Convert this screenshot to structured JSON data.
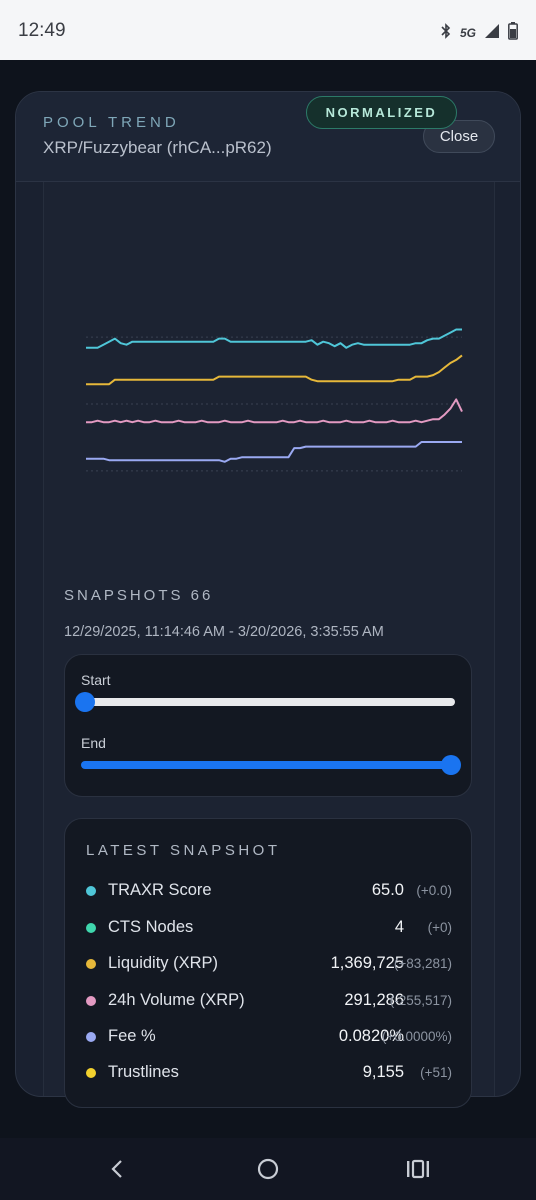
{
  "status_bar": {
    "time": "12:49",
    "network": "5G",
    "icons": [
      "bluetooth-icon",
      "signal-icon",
      "battery-icon"
    ]
  },
  "header": {
    "eyebrow": "POOL TREND",
    "pool_name": "XRP/Fuzzybear (rhCA...pR62)",
    "close_label": "Close"
  },
  "badge": "NORMALIZED",
  "chart_data": {
    "type": "line",
    "title": "",
    "normalized": true,
    "grid": true,
    "x_count": 66,
    "series": [
      {
        "color": "#4fc6d8",
        "values": [
          0.87,
          0.87,
          0.87,
          0.89,
          0.91,
          0.93,
          0.9,
          0.89,
          0.91,
          0.91,
          0.91,
          0.91,
          0.91,
          0.91,
          0.91,
          0.91,
          0.91,
          0.91,
          0.91,
          0.91,
          0.91,
          0.91,
          0.91,
          0.93,
          0.93,
          0.91,
          0.91,
          0.91,
          0.91,
          0.91,
          0.91,
          0.91,
          0.91,
          0.91,
          0.91,
          0.91,
          0.91,
          0.91,
          0.91,
          0.92,
          0.89,
          0.91,
          0.9,
          0.88,
          0.9,
          0.87,
          0.89,
          0.9,
          0.89,
          0.89,
          0.89,
          0.89,
          0.89,
          0.89,
          0.89,
          0.89,
          0.89,
          0.9,
          0.9,
          0.92,
          0.93,
          0.93,
          0.95,
          0.97,
          0.99,
          0.99
        ]
      },
      {
        "color": "#e6b83a",
        "values": [
          0.63,
          0.63,
          0.63,
          0.63,
          0.63,
          0.66,
          0.66,
          0.66,
          0.66,
          0.66,
          0.66,
          0.66,
          0.66,
          0.66,
          0.66,
          0.66,
          0.66,
          0.66,
          0.66,
          0.66,
          0.66,
          0.66,
          0.66,
          0.68,
          0.68,
          0.68,
          0.68,
          0.68,
          0.68,
          0.68,
          0.68,
          0.68,
          0.68,
          0.68,
          0.68,
          0.68,
          0.68,
          0.68,
          0.68,
          0.66,
          0.65,
          0.65,
          0.65,
          0.65,
          0.65,
          0.65,
          0.65,
          0.65,
          0.65,
          0.65,
          0.65,
          0.65,
          0.65,
          0.65,
          0.66,
          0.66,
          0.66,
          0.68,
          0.68,
          0.68,
          0.69,
          0.71,
          0.74,
          0.77,
          0.79,
          0.82
        ]
      },
      {
        "color": "#e39ac2",
        "values": [
          0.38,
          0.38,
          0.39,
          0.38,
          0.38,
          0.39,
          0.38,
          0.39,
          0.38,
          0.39,
          0.38,
          0.38,
          0.39,
          0.38,
          0.38,
          0.38,
          0.39,
          0.38,
          0.38,
          0.38,
          0.39,
          0.38,
          0.38,
          0.38,
          0.39,
          0.38,
          0.38,
          0.38,
          0.39,
          0.38,
          0.38,
          0.38,
          0.38,
          0.38,
          0.39,
          0.38,
          0.38,
          0.39,
          0.38,
          0.38,
          0.38,
          0.39,
          0.38,
          0.38,
          0.38,
          0.39,
          0.38,
          0.38,
          0.38,
          0.39,
          0.38,
          0.38,
          0.38,
          0.39,
          0.38,
          0.38,
          0.38,
          0.39,
          0.38,
          0.39,
          0.4,
          0.4,
          0.43,
          0.47,
          0.53,
          0.45
        ]
      },
      {
        "color": "#9aa9f2",
        "values": [
          0.14,
          0.14,
          0.14,
          0.14,
          0.13,
          0.13,
          0.13,
          0.13,
          0.13,
          0.13,
          0.13,
          0.13,
          0.13,
          0.13,
          0.13,
          0.13,
          0.13,
          0.13,
          0.13,
          0.13,
          0.13,
          0.13,
          0.13,
          0.13,
          0.12,
          0.14,
          0.14,
          0.15,
          0.15,
          0.15,
          0.15,
          0.15,
          0.15,
          0.15,
          0.15,
          0.15,
          0.21,
          0.21,
          0.22,
          0.22,
          0.22,
          0.22,
          0.22,
          0.22,
          0.22,
          0.22,
          0.22,
          0.22,
          0.22,
          0.22,
          0.22,
          0.22,
          0.22,
          0.22,
          0.22,
          0.22,
          0.22,
          0.22,
          0.25,
          0.25,
          0.25,
          0.25,
          0.25,
          0.25,
          0.25,
          0.25
        ]
      }
    ]
  },
  "snapshots": {
    "heading": "SNAPSHOTS 66",
    "range": "12/29/2025, 11:14:46 AM - 3/20/2026, 3:35:55 AM",
    "start_label": "Start",
    "end_label": "End",
    "start_position": 0,
    "end_position": 1
  },
  "latest": {
    "title": "LATEST SNAPSHOT",
    "rows": [
      {
        "label": "TRAXR Score",
        "value": "65.0",
        "delta": "(+0.0)",
        "color": "#4fc6d8"
      },
      {
        "label": "CTS Nodes",
        "value": "4",
        "delta": "(+0)",
        "color": "#3fd6ad"
      },
      {
        "label": "Liquidity (XRP)",
        "value": "1,369,725",
        "delta": "(+83,281)",
        "color": "#e6b83a"
      },
      {
        "label": "24h Volume (XRP)",
        "value": "291,286",
        "delta": "(-255,517)",
        "color": "#e39ac2"
      },
      {
        "label": "Fee %",
        "value": "0.0820%",
        "delta": "(+0.0000%)",
        "color": "#9aa9f2"
      },
      {
        "label": "Trustlines",
        "value": "9,155",
        "delta": "(+51)",
        "color": "#f2d12e"
      }
    ]
  },
  "nav": {
    "icons": [
      "back-icon",
      "home-icon",
      "recents-icon"
    ]
  }
}
